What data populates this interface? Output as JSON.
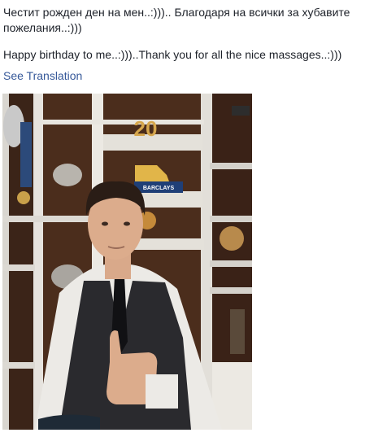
{
  "post": {
    "text_bg": "Честит рожден ден на мен..:))).. Благодаря на всички за хубавите пожелания..:)))",
    "text_en": "Happy birthday to me..:)))..Thank you for all the nice massages..:)))",
    "see_translation": "See Translation"
  },
  "photo": {
    "trophy_number": "20",
    "award_label": "BARCLAYS"
  },
  "colors": {
    "link": "#365899",
    "text": "#1d2129"
  }
}
